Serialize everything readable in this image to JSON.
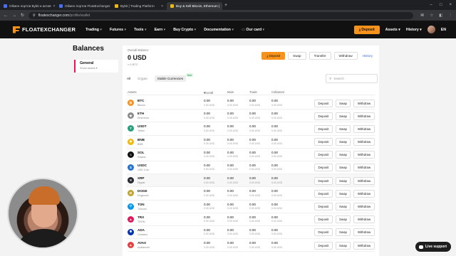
{
  "browser": {
    "tabs": [
      {
        "title": "Обмен портов Bybit и актив",
        "active": false
      },
      {
        "title": "Обмен портов FloatExchanger",
        "active": false
      },
      {
        "title": "Bybit | Trading Platform",
        "active": false
      },
      {
        "title": "Buy & Sell Bitcoin, Ethereum |",
        "active": true
      }
    ],
    "url_host": "floatexchanger.com",
    "url_path": "/profile/wallet"
  },
  "header": {
    "brand": "FLOATEXCHANGER",
    "nav": [
      "Trading",
      "Futures",
      "Tools",
      "Earn",
      "Buy Crypto",
      "Documentation",
      "Our card"
    ],
    "deposit": "Deposit",
    "assets": "Assets",
    "history": "History",
    "lang": "EN"
  },
  "page": {
    "title": "Balances",
    "sidenav": {
      "title": "General",
      "subtitle": "Show assets"
    }
  },
  "overview": {
    "label": "Overall Balance",
    "value": "0 USD",
    "btc": "≈ 0 BTC",
    "actions": {
      "deposit": "Deposit",
      "swap": "Swap",
      "transfer": "Transfer",
      "withdraw": "Withdraw",
      "history": "History"
    }
  },
  "filters": {
    "all": "All",
    "crypto": "Crypto",
    "stable": "Stable Currencies",
    "new_badge": "New"
  },
  "search": {
    "placeholder": "Search"
  },
  "table": {
    "headers": {
      "assets": "Assets",
      "overall": "Overall",
      "main": "Main",
      "trade": "Trade",
      "collateral": "Collateral"
    },
    "row_buttons": {
      "deposit": "Deposit",
      "swap": "Swap",
      "withdraw": "Withdraw"
    },
    "rows": [
      {
        "symbol": "BTC",
        "name": "Bitcoin",
        "color": "#f7931a",
        "glyph": "₿"
      },
      {
        "symbol": "ETH",
        "name": "Ethereum",
        "color": "#8c8c8c",
        "glyph": "◆"
      },
      {
        "symbol": "USDT",
        "name": "Tether",
        "color": "#26a17b",
        "glyph": "T"
      },
      {
        "symbol": "BNB",
        "name": "BNB",
        "color": "#f0b90b",
        "glyph": "◆"
      },
      {
        "symbol": "SOL",
        "name": "Solana",
        "color": "#111111",
        "glyph": "≡"
      },
      {
        "symbol": "USDC",
        "name": "USD Coin",
        "color": "#2775ca",
        "glyph": "$"
      },
      {
        "symbol": "XRP",
        "name": "Ripple",
        "color": "#23292f",
        "glyph": "✕"
      },
      {
        "symbol": "DOGE",
        "name": "Dogecoin",
        "color": "#c2a633",
        "glyph": "Ð"
      },
      {
        "symbol": "TON",
        "name": "Toncoin",
        "color": "#0098ea",
        "glyph": "▽"
      },
      {
        "symbol": "TRX",
        "name": "TRON",
        "color": "#e0195b",
        "glyph": "▲"
      },
      {
        "symbol": "ADA",
        "name": "Cardano",
        "color": "#0033ad",
        "glyph": "✱"
      },
      {
        "symbol": "AVAX",
        "name": "Avalanche",
        "color": "#e84142",
        "glyph": "▲"
      }
    ],
    "zero_value": "0.00",
    "zero_usd": "0.00 USD"
  },
  "chat": {
    "label": "Live support"
  }
}
